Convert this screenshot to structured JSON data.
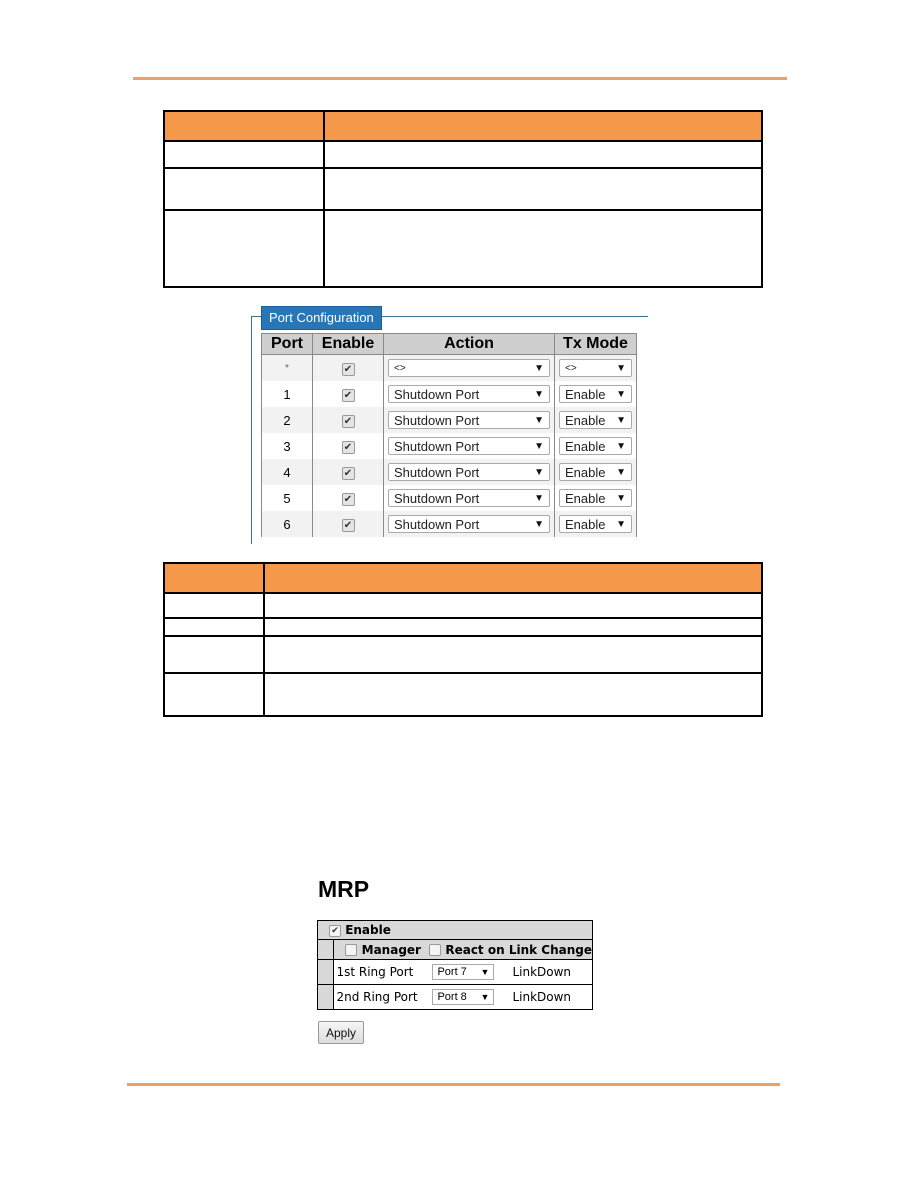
{
  "colors": {
    "rule": "#f0a060",
    "table_header": "#f5984a",
    "legend_bg": "#2777b8"
  },
  "doc_table_1": {
    "header": [
      "",
      ""
    ],
    "rows": [
      [
        "",
        ""
      ],
      [
        "",
        ""
      ],
      [
        "",
        ""
      ]
    ]
  },
  "port_config": {
    "legend": "Port Configuration",
    "columns": [
      "Port",
      "Enable",
      "Action",
      "Tx Mode"
    ],
    "rows": [
      {
        "port": "*",
        "enable": true,
        "action": "<>",
        "tx_mode": "<>"
      },
      {
        "port": "1",
        "enable": true,
        "action": "Shutdown Port",
        "tx_mode": "Enable"
      },
      {
        "port": "2",
        "enable": true,
        "action": "Shutdown Port",
        "tx_mode": "Enable"
      },
      {
        "port": "3",
        "enable": true,
        "action": "Shutdown Port",
        "tx_mode": "Enable"
      },
      {
        "port": "4",
        "enable": true,
        "action": "Shutdown Port",
        "tx_mode": "Enable"
      },
      {
        "port": "5",
        "enable": true,
        "action": "Shutdown Port",
        "tx_mode": "Enable"
      },
      {
        "port": "6",
        "enable": true,
        "action": "Shutdown Port",
        "tx_mode": "Enable"
      }
    ]
  },
  "doc_table_2": {
    "header": [
      "",
      ""
    ],
    "rows": [
      [
        "",
        ""
      ],
      [
        "",
        ""
      ],
      [
        "",
        ""
      ],
      [
        "",
        ""
      ]
    ]
  },
  "mrp": {
    "title": "MRP",
    "enable_label": "Enable",
    "enable_checked": true,
    "manager_label": "Manager",
    "manager_checked": false,
    "react_label": "React on Link Change",
    "react_checked": false,
    "ring_ports": [
      {
        "label": "1st Ring Port",
        "value": "Port 7",
        "status": "LinkDown"
      },
      {
        "label": "2nd Ring Port",
        "value": "Port 8",
        "status": "LinkDown"
      }
    ],
    "apply_label": "Apply",
    "check_glyph": "✔",
    "dropdown_glyph": "▼"
  }
}
